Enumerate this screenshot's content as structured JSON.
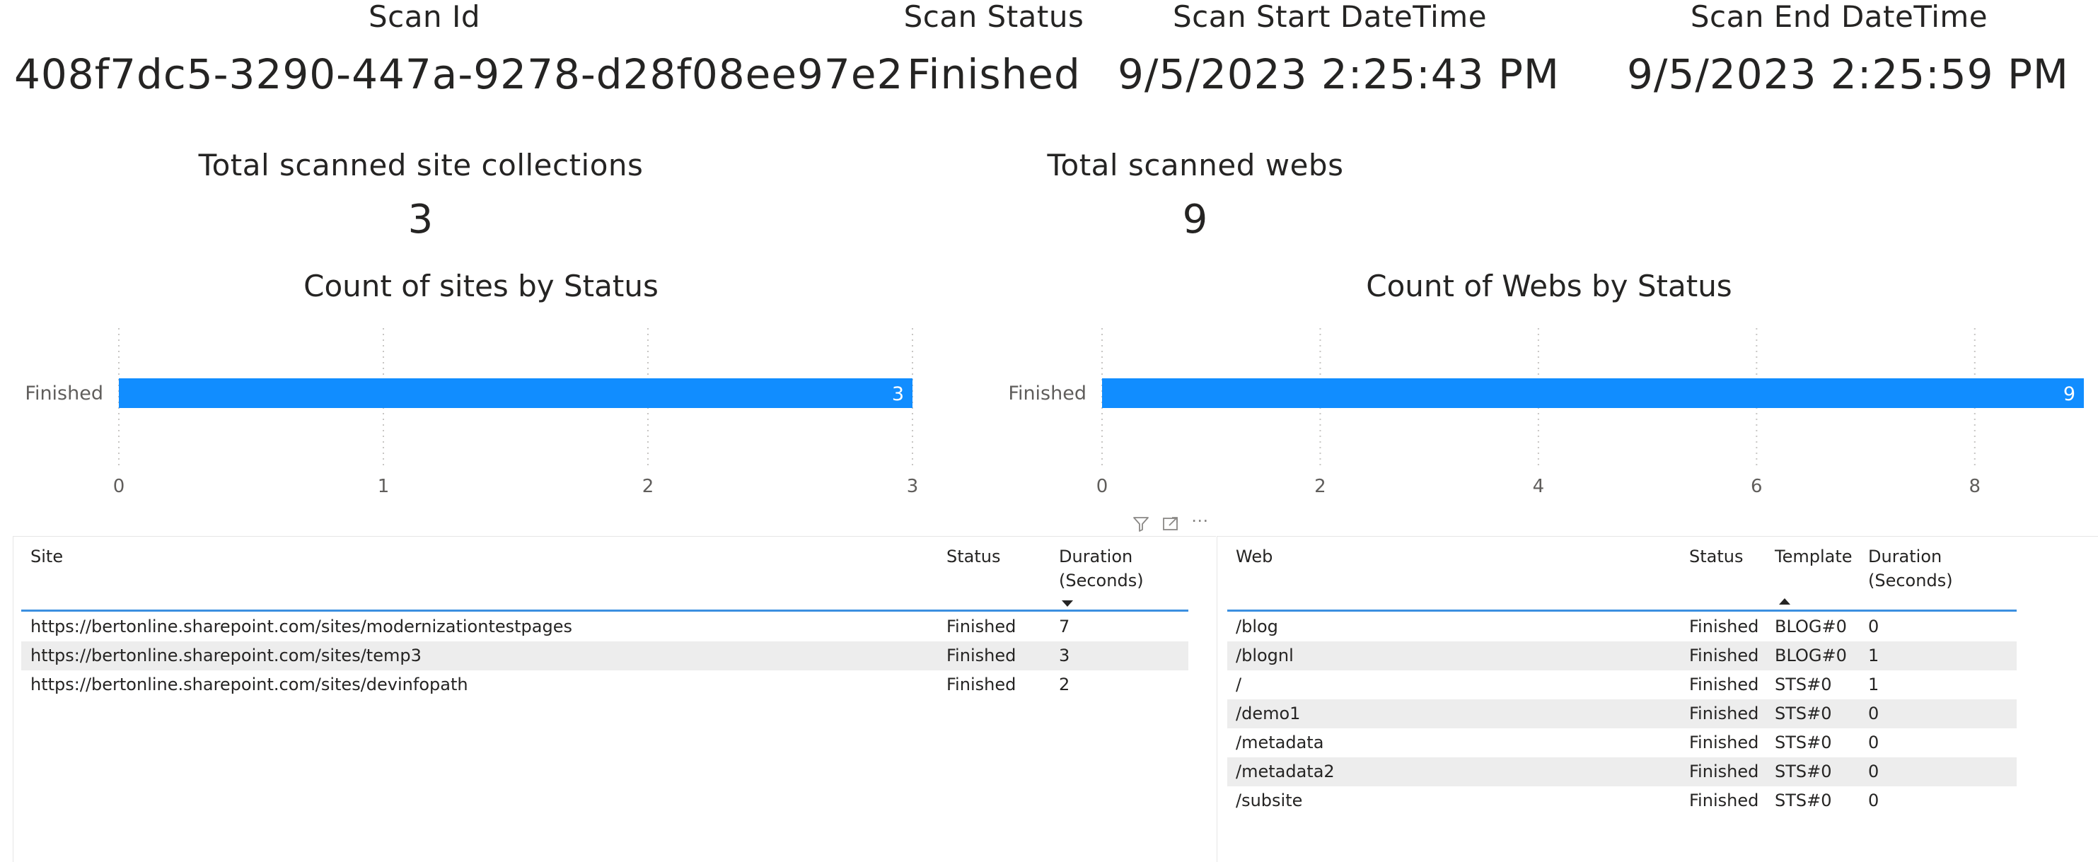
{
  "cards": {
    "scan_id": {
      "label": "Scan Id",
      "value": "408f7dc5-3290-447a-9278-d28f08ee97e2"
    },
    "scan_status": {
      "label": "Scan Status",
      "value": "Finished"
    },
    "scan_start": {
      "label": "Scan Start DateTime",
      "value": "9/5/2023 2:25:43 PM"
    },
    "scan_end": {
      "label": "Scan End DateTime",
      "value": "9/5/2023 2:25:59 PM"
    },
    "total_sites": {
      "label": "Total scanned site collections",
      "value": "3"
    },
    "total_webs": {
      "label": "Total scanned webs",
      "value": "9"
    }
  },
  "colors": {
    "bar": "#118dff",
    "accent_line": "#3b8fe0",
    "alt_row": "#ededed",
    "text": "#252423",
    "axis_text": "#605e5c"
  },
  "chart_data": [
    {
      "type": "bar",
      "orientation": "horizontal",
      "title": "Count of sites by Status",
      "categories": [
        "Finished"
      ],
      "values": [
        3
      ],
      "data_labels": [
        "3"
      ],
      "xlim": [
        0,
        3
      ],
      "xticks": [
        "0",
        "1",
        "2",
        "3"
      ],
      "grid": "vertical dotted"
    },
    {
      "type": "bar",
      "orientation": "horizontal",
      "title": "Count of Webs by Status",
      "categories": [
        "Finished"
      ],
      "values": [
        9
      ],
      "data_labels": [
        "9"
      ],
      "xlim": [
        0,
        9
      ],
      "xticks": [
        "0",
        "2",
        "4",
        "6",
        "8"
      ],
      "grid": "vertical dotted"
    }
  ],
  "sites_table": {
    "toolbar_icons": [
      "filter-icon",
      "focus-mode-icon",
      "more-options-icon"
    ],
    "headers": {
      "site": "Site",
      "status": "Status",
      "duration_1": "Duration",
      "duration_2": "(Seconds)"
    },
    "sort": "duration-descending",
    "rows": [
      {
        "site": "https://bertonline.sharepoint.com/sites/modernizationtestpages",
        "status": "Finished",
        "duration": "7"
      },
      {
        "site": "https://bertonline.sharepoint.com/sites/temp3",
        "status": "Finished",
        "duration": "3"
      },
      {
        "site": "https://bertonline.sharepoint.com/sites/devinfopath",
        "status": "Finished",
        "duration": "2"
      }
    ]
  },
  "webs_table": {
    "headers": {
      "web": "Web",
      "status": "Status",
      "template": "Template",
      "duration_1": "Duration",
      "duration_2": "(Seconds)"
    },
    "sort": "template-ascending",
    "rows": [
      {
        "web": "/blog",
        "status": "Finished",
        "template": "BLOG#0",
        "duration": "0"
      },
      {
        "web": "/blognl",
        "status": "Finished",
        "template": "BLOG#0",
        "duration": "1"
      },
      {
        "web": "/",
        "status": "Finished",
        "template": "STS#0",
        "duration": "1"
      },
      {
        "web": "/demo1",
        "status": "Finished",
        "template": "STS#0",
        "duration": "0"
      },
      {
        "web": "/metadata",
        "status": "Finished",
        "template": "STS#0",
        "duration": "0"
      },
      {
        "web": "/metadata2",
        "status": "Finished",
        "template": "STS#0",
        "duration": "0"
      },
      {
        "web": "/subsite",
        "status": "Finished",
        "template": "STS#0",
        "duration": "0"
      }
    ]
  }
}
